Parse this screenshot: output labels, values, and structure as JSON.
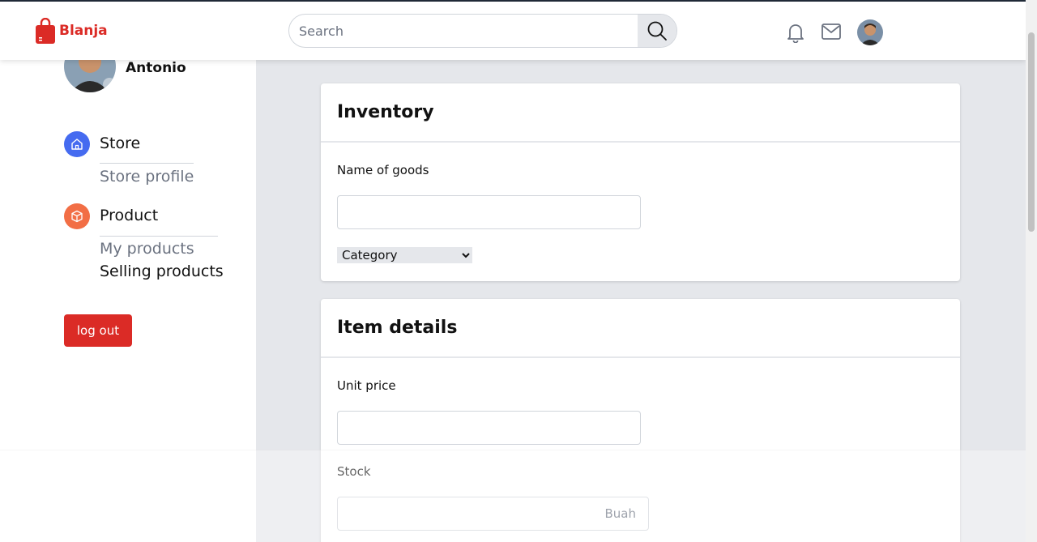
{
  "header": {
    "brand": "Blanja",
    "search_placeholder": "Search"
  },
  "sidebar": {
    "username": "Antonio",
    "sections": [
      {
        "title": "Store",
        "icon": "home-icon",
        "color": "#456bf0",
        "items": [
          "Store profile"
        ]
      },
      {
        "title": "Product",
        "icon": "box-icon",
        "color": "#f26e45",
        "items": [
          "My products",
          "Selling products"
        ]
      }
    ],
    "logout_label": "log out"
  },
  "inventory": {
    "title": "Inventory",
    "name_label": "Name of goods",
    "category_options": [
      "Category"
    ]
  },
  "item_details": {
    "title": "Item details",
    "price_label": "Unit price",
    "stock_label": "Stock",
    "stock_suffix": "Buah"
  },
  "colors": {
    "brand": "#db2b26",
    "store_icon": "#456bf0",
    "product_icon": "#f26e45"
  }
}
